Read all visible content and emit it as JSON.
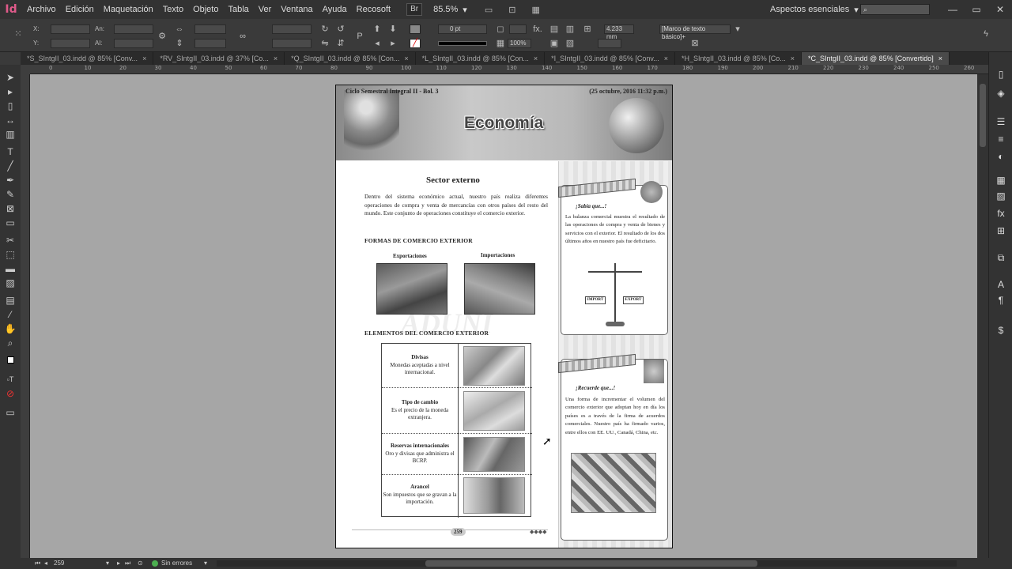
{
  "app": {
    "logo": "Id",
    "zoom": "85.5%",
    "zoom_arrow": "▾",
    "workspace": "Aspectos esenciales",
    "workspace_arrow": "▾"
  },
  "menu": [
    "Archivo",
    "Edición",
    "Maquetación",
    "Texto",
    "Objeto",
    "Tabla",
    "Ver",
    "Ventana",
    "Ayuda",
    "Recosoft"
  ],
  "menu_box": "Br",
  "controls": {
    "x_label": "X:",
    "y_label": "Y:",
    "w_label": "An:",
    "h_label": "Al:",
    "stroke_value": "0 pt",
    "dimension_value": "4.233 mm",
    "scale_value": "100%",
    "frame_style": "[Marco de texto básico]+",
    "fx_label": "fx."
  },
  "tabs": [
    {
      "label": "*S_SIntgII_03.indd @ 85% [Conv...",
      "close": "×",
      "active": false
    },
    {
      "label": "*RV_SIntgII_03.indd @ 37% [Co...",
      "close": "×",
      "active": false
    },
    {
      "label": "*Q_SIntgII_03.indd @ 85% [Con...",
      "close": "×",
      "active": false
    },
    {
      "label": "*L_SIntgII_03.indd @ 85% [Con...",
      "close": "×",
      "active": false
    },
    {
      "label": "*I_SIntgII_03.indd @ 85% [Conv...",
      "close": "×",
      "active": false
    },
    {
      "label": "*H_SIntgII_03.indd @ 85% [Co...",
      "close": "×",
      "active": false
    },
    {
      "label": "*C_SIntgII_03.indd @ 85% [Convertido]",
      "close": "×",
      "active": true
    }
  ],
  "ruler_ticks": [
    "0",
    "10",
    "20",
    "30",
    "40",
    "50",
    "60",
    "70",
    "80",
    "90",
    "100",
    "110",
    "120",
    "130",
    "140",
    "150",
    "160",
    "170",
    "180",
    "190",
    "200",
    "210",
    "220",
    "230",
    "240",
    "250",
    "260"
  ],
  "status": {
    "page": "259",
    "preflight": "Sin errores"
  },
  "document": {
    "header_left": "Ciclo Semestral Integral II - Bol. 3",
    "header_right": "(25 octubre, 2016 11:32 p.m.)",
    "banner_title": "Economía",
    "section_title": "Sector externo",
    "intro": "Dentro del sistema económico actual, nuestro país realiza diferentes operaciones de compra y venta de mercancías con otros países del resto del mundo. Este conjunto de operaciones constituye el comercio exterior.",
    "forms_heading": "FORMAS DE COMERCIO EXTERIOR",
    "exports_label": "Exportaciones",
    "imports_label": "Importaciones",
    "elements_heading": "ELEMENTOS DEL COMERCIO EXTERIOR",
    "elements": [
      {
        "title": "Divisas",
        "desc": "Monedas aceptadas a nivel internacional."
      },
      {
        "title": "Tipo de cambio",
        "desc": "Es el precio de la moneda extranjera."
      },
      {
        "title": "Reservas internacionales",
        "desc": "Oro y divisas que administra el BCRP."
      },
      {
        "title": "Arancel",
        "desc": "Son impuestos que se gravan a la importación."
      }
    ],
    "page_number": "259",
    "diamonds": "◆◆◆◆",
    "sabia_title": "¡Sabía que...!",
    "sabia_text": "La balanza comercial muestra el resultado de las operaciones de compra y venta de bienes y servicios con el exterior. El resultado de los dos últimos años en nuestro país fue deficitario.",
    "scale_left": "IMPORT",
    "scale_right": "EXPORT",
    "recuerde_title": "¡Recuerde que...!",
    "recuerde_text": "Una forma de incrementar el volumen del comercio exterior que adoptan hoy en día los países es a través de la firma de acuerdos comerciales. Nuestro país ha firmado varios, entre ellos con EE. UU., Canadá, China, etc.",
    "watermark": "ADUNI"
  }
}
